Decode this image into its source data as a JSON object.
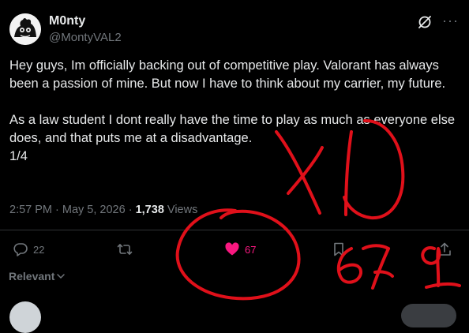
{
  "author": {
    "display_name": "M0nty",
    "handle": "@MontyVAL2"
  },
  "post": {
    "text": "Hey guys, Im officially backing out of competitive play. Valorant has always been a passion of mine. But now I have to think about my carrier, my future.\n\nAs a law student I dont really have the time to play as much as everyone else does, and that puts me at a disadvantage.\n1/4",
    "time": "2:57 PM",
    "date": "May 5, 2026",
    "views_count": "1,738",
    "views_label": "Views"
  },
  "actions": {
    "reply_count": "22",
    "like_count": "67"
  },
  "sort": {
    "label": "Relevant"
  },
  "colors": {
    "background": "#000000",
    "text": "#e7e9ea",
    "muted": "#71767b",
    "like": "#f91880",
    "annotation": "#e0101a"
  },
  "icons": [
    "avatar",
    "grok-icon",
    "more-icon",
    "reply-icon",
    "repost-icon",
    "heart-icon",
    "bookmark-icon",
    "share-icon",
    "chevron-down-icon"
  ]
}
